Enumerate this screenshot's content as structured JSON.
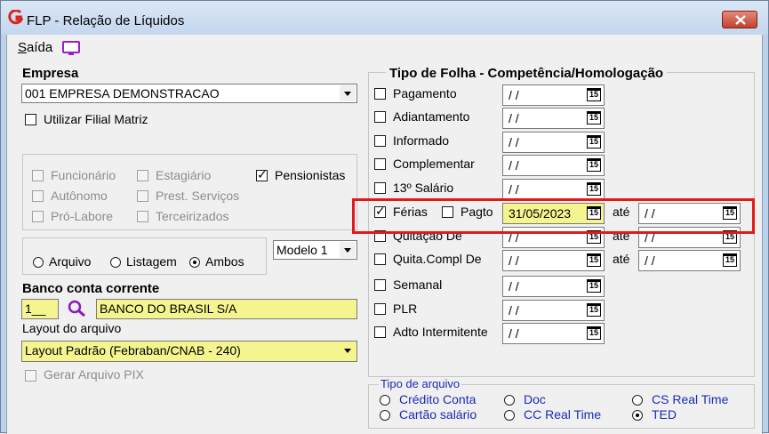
{
  "window": {
    "title": "FLP - Relação de Líquidos"
  },
  "menu": {
    "saida_prefix": "S",
    "saida_rest": "aída"
  },
  "empresa": {
    "label": "Empresa",
    "value": "001 EMPRESA DEMONSTRACAO",
    "filial_label": "Utilizar Filial Matriz"
  },
  "categorias": {
    "funcionario": "Funcionário",
    "estagiario": "Estagiário",
    "pensionistas": "Pensionistas",
    "autonomo": "Autônomo",
    "prest_servicos": "Prest. Serviços",
    "pro_labore": "Pró-Labore",
    "terceirizados": "Terceirizados"
  },
  "saida_tipo": {
    "arquivo": "Arquivo",
    "listagem": "Listagem",
    "ambos": "Ambos",
    "selected": "Ambos"
  },
  "modelo": {
    "value": "Modelo 1"
  },
  "banco": {
    "label": "Banco conta corrente",
    "code": "1__",
    "name": "BANCO DO BRASIL S/A"
  },
  "layout": {
    "label": "Layout do arquivo",
    "value": "Layout Padrão (Febraban/CNAB - 240)"
  },
  "pix": {
    "label": "Gerar Arquivo PIX"
  },
  "folha": {
    "header": "Tipo de Folha  -  Competência/Homologação",
    "ate": "até",
    "pagto_label": "Pagto",
    "rows": [
      {
        "label": "Pagamento",
        "date": "/ /",
        "checked": false
      },
      {
        "label": "Adiantamento",
        "date": "/ /",
        "checked": false
      },
      {
        "label": "Informado",
        "date": "/ /",
        "checked": false
      },
      {
        "label": "Complementar",
        "date": "/ /",
        "checked": false
      },
      {
        "label": "13º Salário",
        "date": "/ /",
        "checked": false
      },
      {
        "label": "Férias",
        "date": "31/05/2023",
        "date_ate": "/ /",
        "checked": true
      },
      {
        "label": "Quitação De",
        "date": "/ /",
        "date_ate": "/ /",
        "checked": false
      },
      {
        "label": "Quita.Compl De",
        "date": "/ /",
        "date_ate": "/ /",
        "checked": false
      },
      {
        "label": "Semanal",
        "date": "/ /",
        "checked": false
      },
      {
        "label": "PLR",
        "date": "/ /",
        "checked": false
      },
      {
        "label": "Adto Intermitente",
        "date": "/ /",
        "checked": false
      }
    ]
  },
  "tipo_arquivo": {
    "label": "Tipo de arquivo",
    "credito_conta": "Crédito Conta",
    "doc": "Doc",
    "cs_real_time": "CS Real Time",
    "cartao_salario": "Cartão salário",
    "cc_real_time": "CC Real Time",
    "ted": "TED",
    "selected": "TED"
  },
  "cal_text": "15",
  "colors": {
    "highlight": "#f5f58f",
    "accent_blue": "#1a2bb5",
    "annotation_red": "#e01a1a"
  }
}
